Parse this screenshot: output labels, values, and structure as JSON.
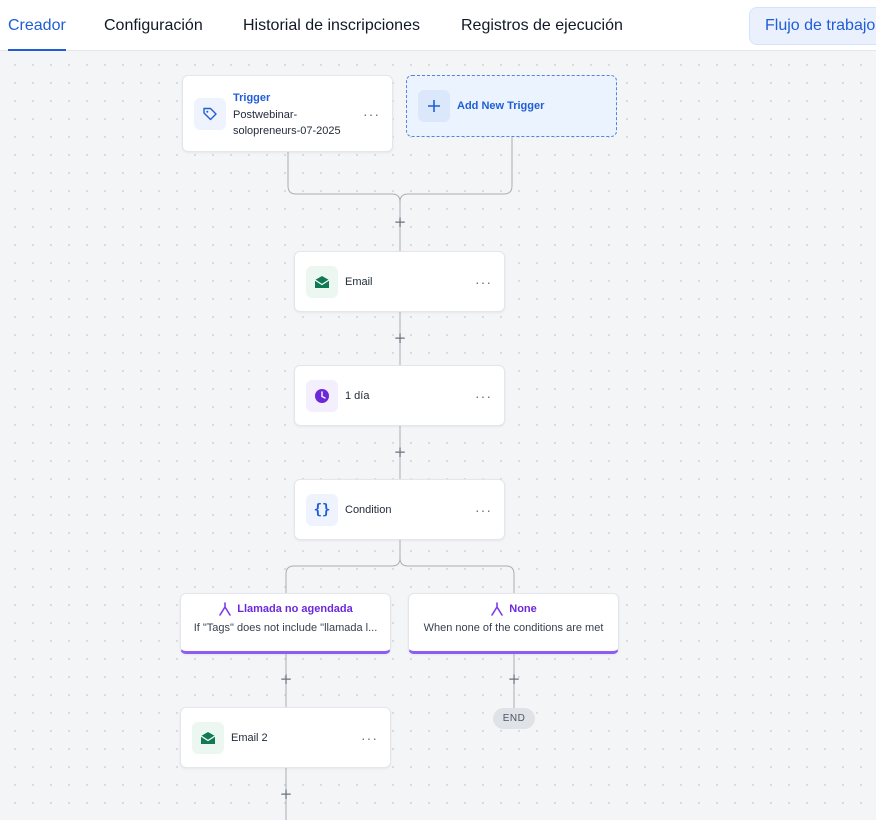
{
  "tabs": [
    {
      "label": "Creador",
      "active": true
    },
    {
      "label": "Configuración",
      "active": false
    },
    {
      "label": "Historial de inscripciones",
      "active": false
    },
    {
      "label": "Registros de ejecución",
      "active": false
    }
  ],
  "workflow_button": "Flujo de trabajo",
  "trigger": {
    "title": "Trigger",
    "name": "Postwebinar-solopreneurs-07-2025",
    "icon": "tag-icon",
    "menu": "···"
  },
  "add_trigger": {
    "icon": "plus-icon",
    "label": "Add New Trigger"
  },
  "plus_symbol": "+",
  "actions": [
    {
      "label": "Email",
      "icon": "email-icon",
      "menu": "···"
    },
    {
      "label": "1 día",
      "icon": "clock-icon",
      "menu": "···"
    },
    {
      "label": "Condition",
      "icon": "braces-icon",
      "menu": "···"
    }
  ],
  "branches": [
    {
      "title": "Llamada no agendada",
      "description": "If \"Tags\" does not include \"llamada l...",
      "icon": "branch-icon"
    },
    {
      "title": "None",
      "description": "When none of the conditions are met",
      "icon": "branch-icon"
    }
  ],
  "branch_action": {
    "label": "Email 2",
    "icon": "email-icon",
    "menu": "···"
  },
  "end_label": "END",
  "colors": {
    "accent": "#1f5ed6",
    "branch_accent": "#8b5cf6",
    "email_green": "#0f7a55",
    "clock_purple": "#6d28d9"
  }
}
